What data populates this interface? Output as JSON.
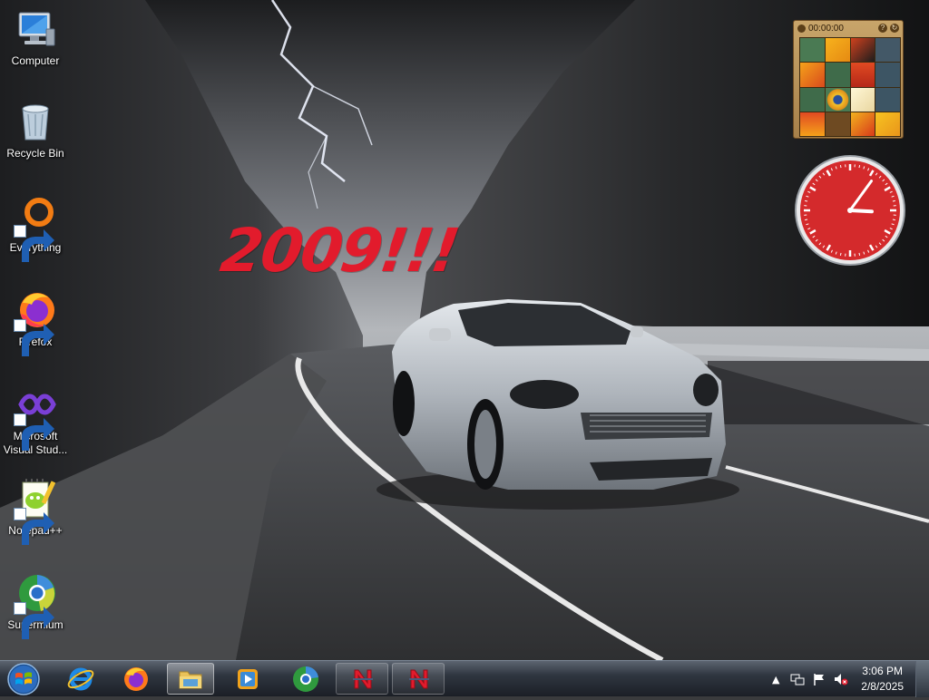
{
  "wallpaper": {
    "overlay_text": "2009!!!"
  },
  "desktop_icons": [
    {
      "label": "Computer",
      "icon": "computer-icon",
      "shortcut": false
    },
    {
      "label": "Recycle Bin",
      "icon": "recycle-bin-icon",
      "shortcut": false
    },
    {
      "label": "Everything",
      "icon": "everything-icon",
      "shortcut": true
    },
    {
      "label": "Firefox",
      "icon": "firefox-icon",
      "shortcut": true
    },
    {
      "label": "Microsoft Visual Stud...",
      "icon": "visual-studio-icon",
      "shortcut": true
    },
    {
      "label": "Notepad++",
      "icon": "notepad-plus-plus-icon",
      "shortcut": true
    },
    {
      "label": "Supermium",
      "icon": "supermium-icon",
      "shortcut": true
    }
  ],
  "gadgets": {
    "puzzle": {
      "timer": "00:00:00",
      "help_label": "?"
    },
    "clock": {
      "hour": 3,
      "minute": 6,
      "face_color": "#d42a2c"
    }
  },
  "taskbar": {
    "start_icon": "windows-start-orb",
    "pinned": [
      {
        "name": "internet-explorer",
        "icon": "ie-icon",
        "state": "normal"
      },
      {
        "name": "firefox",
        "icon": "firefox-icon",
        "state": "normal"
      },
      {
        "name": "windows-explorer",
        "icon": "folder-icon",
        "state": "active"
      },
      {
        "name": "windows-media-player",
        "icon": "media-player-icon",
        "state": "normal"
      },
      {
        "name": "supermium",
        "icon": "supermium-icon",
        "state": "normal"
      },
      {
        "name": "app-n-1",
        "icon": "n-app-icon",
        "state": "group"
      },
      {
        "name": "app-n-2",
        "icon": "n-app-icon",
        "state": "group"
      }
    ],
    "tray": {
      "icons": [
        "show-hidden-icons-arrow",
        "network-icon",
        "action-center-flag-icon",
        "volume-muted-icon"
      ],
      "time": "3:06 PM",
      "date": "2/8/2025"
    }
  }
}
